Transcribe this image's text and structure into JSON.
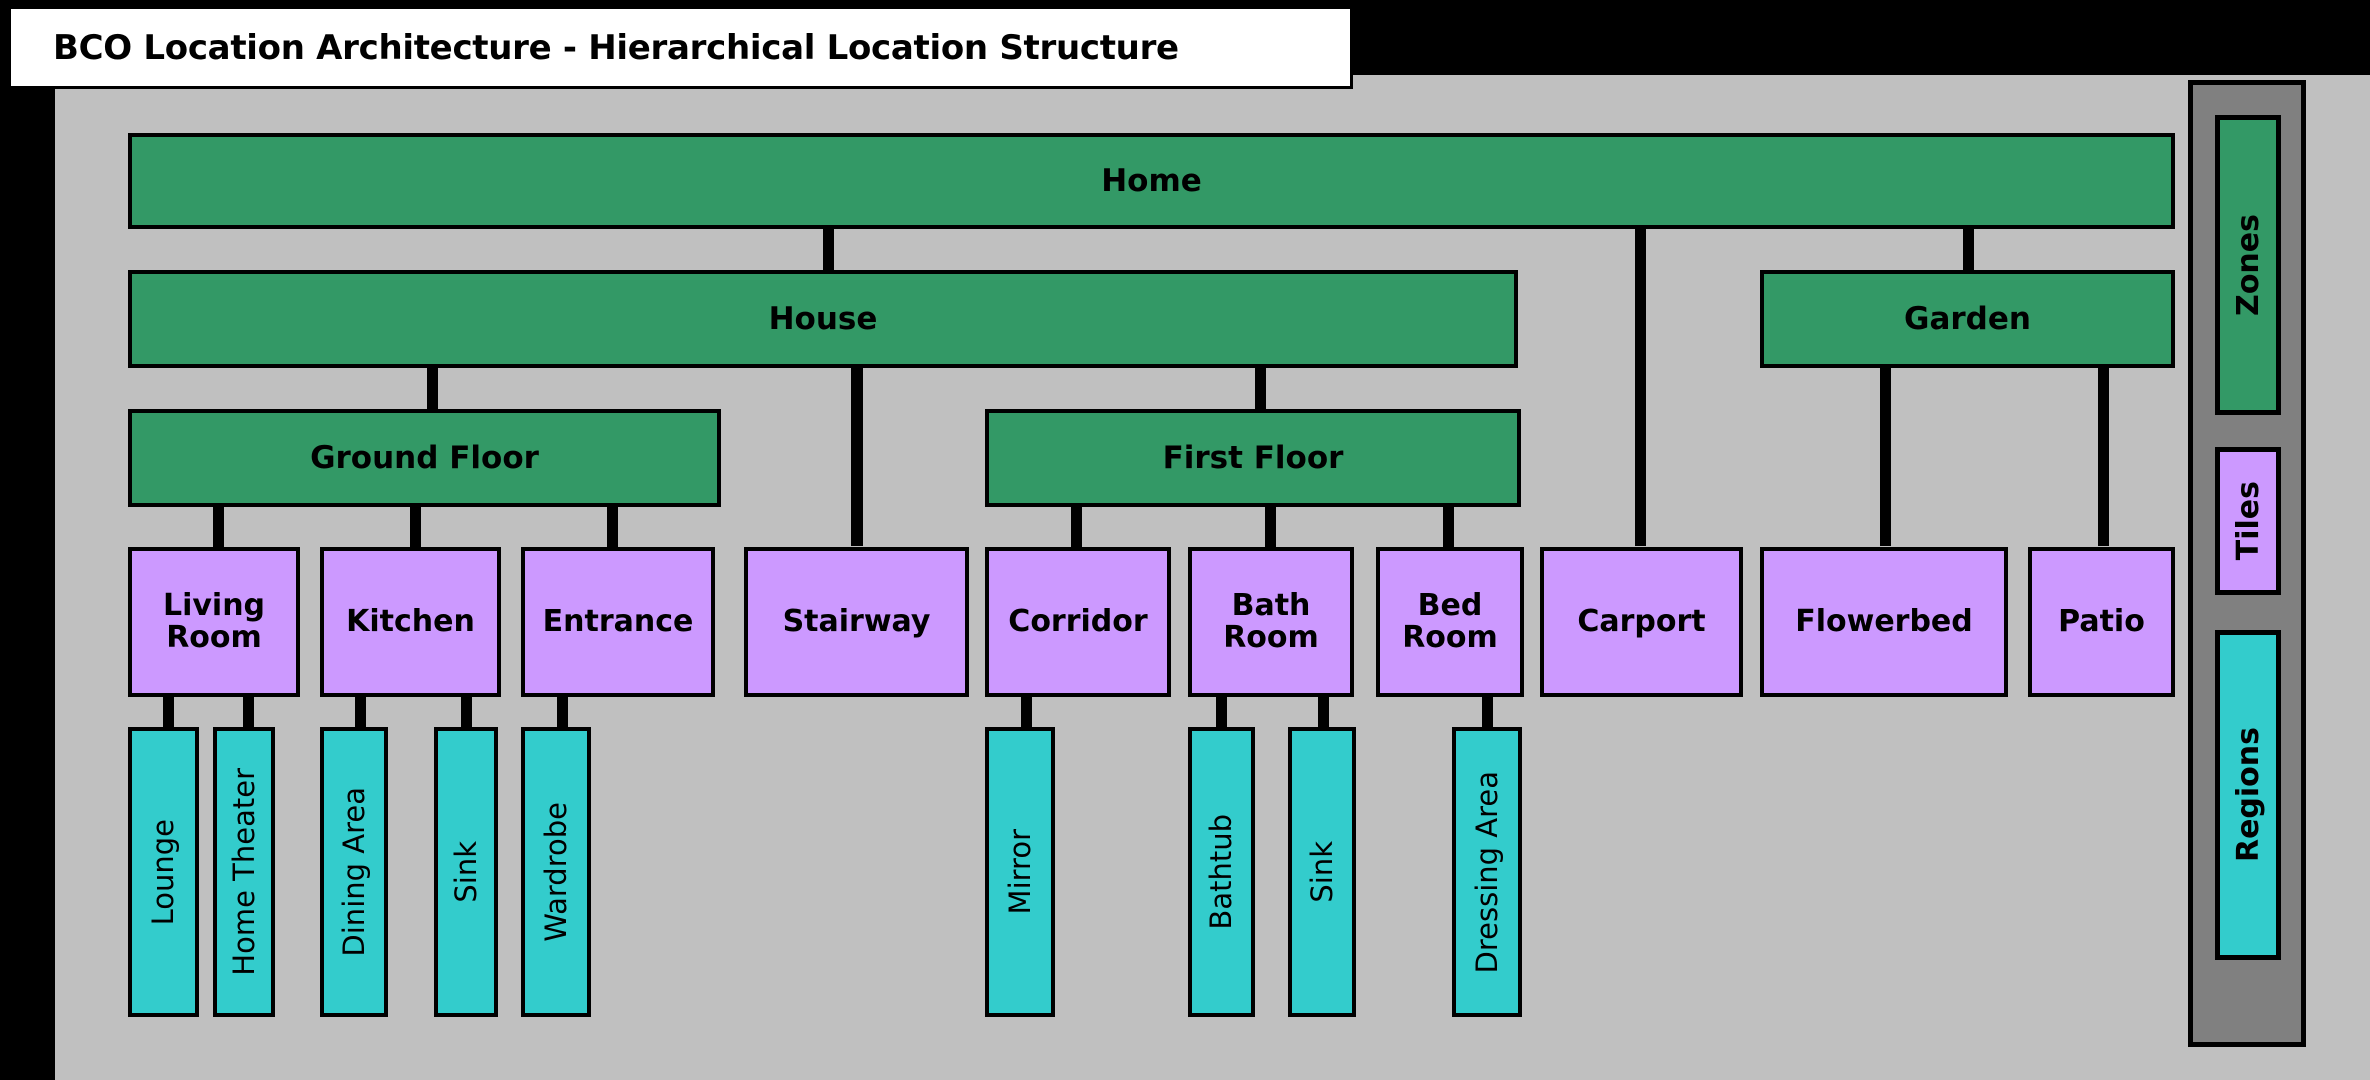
{
  "title": {
    "text": "BCO Location Architecture - Hierarchical Location Structure"
  },
  "colors": {
    "zone": "#339966",
    "tile": "#cc99ff",
    "region": "#33cccc",
    "canvas": "#c0c0c0",
    "legend_panel": "#808080",
    "border": "#000000",
    "page": "#000000",
    "title_bg": "#ffffff"
  },
  "legend": {
    "items": [
      {
        "label": "Zones",
        "type": "zone"
      },
      {
        "label": "Tiles",
        "type": "tile"
      },
      {
        "label": "Regions",
        "type": "region"
      }
    ]
  },
  "diagram": {
    "levels": {
      "level0": [
        "Home"
      ],
      "level1": [
        "House",
        "Garden"
      ],
      "level2": [
        "Ground Floor",
        "First Floor"
      ],
      "level3": [
        "Living Room",
        "Kitchen",
        "Entrance",
        "Stairway",
        "Corridor",
        "Bath Room",
        "Bed Room",
        "Carport",
        "Flowerbed",
        "Patio"
      ],
      "level4": [
        "Lounge",
        "Home Theater",
        "Dining Area",
        "Sink",
        "Wardrobe",
        "Mirror",
        "Bathtub",
        "Sink",
        "Dressing Area"
      ]
    },
    "zones": {
      "home": "Home",
      "house": "House",
      "garden": "Garden",
      "ground_floor": "Ground Floor",
      "first_floor": "First Floor"
    },
    "tiles": {
      "living_room": "Living Room",
      "kitchen": "Kitchen",
      "entrance": "Entrance",
      "stairway": "Stairway",
      "corridor": "Corridor",
      "bath_room": "Bath Room",
      "bed_room": "Bed Room",
      "carport": "Carport",
      "flowerbed": "Flowerbed",
      "patio": "Patio"
    },
    "regions": {
      "lounge": "Lounge",
      "home_theater": "Home Theater",
      "dining_area": "Dining Area",
      "kitchen_sink": "Sink",
      "wardrobe": "Wardrobe",
      "mirror": "Mirror",
      "bathtub": "Bathtub",
      "bath_sink": "Sink",
      "dressing_area": "Dressing Area"
    },
    "edges": [
      {
        "from": "Home",
        "to": "House"
      },
      {
        "from": "Home",
        "to": "Carport"
      },
      {
        "from": "Home",
        "to": "Garden"
      },
      {
        "from": "House",
        "to": "Ground Floor"
      },
      {
        "from": "House",
        "to": "Stairway"
      },
      {
        "from": "House",
        "to": "First Floor"
      },
      {
        "from": "Garden",
        "to": "Flowerbed"
      },
      {
        "from": "Garden",
        "to": "Patio"
      },
      {
        "from": "Ground Floor",
        "to": "Living Room"
      },
      {
        "from": "Ground Floor",
        "to": "Kitchen"
      },
      {
        "from": "Ground Floor",
        "to": "Entrance"
      },
      {
        "from": "First Floor",
        "to": "Corridor"
      },
      {
        "from": "First Floor",
        "to": "Bath Room"
      },
      {
        "from": "First Floor",
        "to": "Bed Room"
      },
      {
        "from": "Living Room",
        "to": "Lounge"
      },
      {
        "from": "Living Room",
        "to": "Home Theater"
      },
      {
        "from": "Kitchen",
        "to": "Dining Area"
      },
      {
        "from": "Kitchen",
        "to": "Sink"
      },
      {
        "from": "Entrance",
        "to": "Wardrobe"
      },
      {
        "from": "Corridor",
        "to": "Mirror"
      },
      {
        "from": "Bath Room",
        "to": "Bathtub"
      },
      {
        "from": "Bath Room",
        "to": "Sink"
      },
      {
        "from": "Bed Room",
        "to": "Dressing Area"
      }
    ]
  }
}
